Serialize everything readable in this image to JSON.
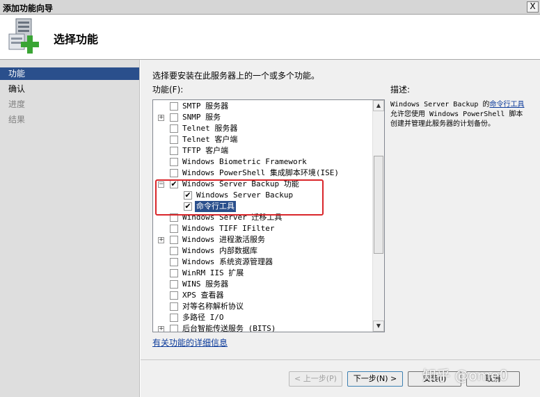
{
  "window": {
    "title": "添加功能向导",
    "close_glyph": "X"
  },
  "header": {
    "title": "选择功能",
    "icon": "server-add-icon"
  },
  "nav": [
    {
      "label": "功能",
      "state": "active"
    },
    {
      "label": "确认",
      "state": "normal"
    },
    {
      "label": "进度",
      "state": "disabled"
    },
    {
      "label": "结果",
      "state": "disabled"
    }
  ],
  "main": {
    "intro": "选择要安装在此服务器上的一个或多个功能。",
    "features_label": "功能(F):",
    "more_info_link": "有关功能的详细信息"
  },
  "features": [
    {
      "label": "SMTP 服务器",
      "checked": false,
      "expander": "",
      "indent": 0,
      "selected": false
    },
    {
      "label": "SNMP 服务",
      "checked": false,
      "expander": "+",
      "indent": 0,
      "selected": false
    },
    {
      "label": "Telnet 服务器",
      "checked": false,
      "expander": "",
      "indent": 0,
      "selected": false
    },
    {
      "label": "Telnet 客户端",
      "checked": false,
      "expander": "",
      "indent": 0,
      "selected": false
    },
    {
      "label": "TFTP 客户端",
      "checked": false,
      "expander": "",
      "indent": 0,
      "selected": false
    },
    {
      "label": "Windows Biometric Framework",
      "checked": false,
      "expander": "",
      "indent": 0,
      "selected": false
    },
    {
      "label": "Windows PowerShell 集成脚本环境(ISE)",
      "checked": false,
      "expander": "",
      "indent": 0,
      "selected": false
    },
    {
      "label": "Windows Server Backup 功能",
      "checked": true,
      "expander": "−",
      "indent": 0,
      "selected": false
    },
    {
      "label": "Windows Server Backup",
      "checked": true,
      "expander": "",
      "indent": 1,
      "selected": false
    },
    {
      "label": "命令行工具",
      "checked": true,
      "expander": "",
      "indent": 1,
      "selected": true
    },
    {
      "label": "Windows Server 迁移工具",
      "checked": false,
      "expander": "",
      "indent": 0,
      "selected": false
    },
    {
      "label": "Windows TIFF IFilter",
      "checked": false,
      "expander": "",
      "indent": 0,
      "selected": false
    },
    {
      "label": "Windows 进程激活服务",
      "checked": false,
      "expander": "+",
      "indent": 0,
      "selected": false
    },
    {
      "label": "Windows 内部数据库",
      "checked": false,
      "expander": "",
      "indent": 0,
      "selected": false
    },
    {
      "label": "Windows 系统资源管理器",
      "checked": false,
      "expander": "",
      "indent": 0,
      "selected": false
    },
    {
      "label": "WinRM IIS 扩展",
      "checked": false,
      "expander": "",
      "indent": 0,
      "selected": false
    },
    {
      "label": "WINS 服务器",
      "checked": false,
      "expander": "",
      "indent": 0,
      "selected": false
    },
    {
      "label": "XPS 查看器",
      "checked": false,
      "expander": "",
      "indent": 0,
      "selected": false
    },
    {
      "label": "对等名称解析协议",
      "checked": false,
      "expander": "",
      "indent": 0,
      "selected": false
    },
    {
      "label": "多路径 I/O",
      "checked": false,
      "expander": "",
      "indent": 0,
      "selected": false
    },
    {
      "label": "后台智能传送服务 (BITS)",
      "checked": false,
      "expander": "+",
      "indent": 0,
      "selected": false
    }
  ],
  "description": {
    "title": "描述:",
    "text_before": "Windows Server Backup 的",
    "link": "命令行工具",
    "text_after": "允许您使用 Windows PowerShell 脚本创建并管理此服务器的计划备份。"
  },
  "buttons": {
    "prev": "< 上一步(P)",
    "next": "下一步(N) >",
    "install": "安装(I)",
    "cancel": "取消"
  },
  "watermark": "知乎 @ome0",
  "colors": {
    "selection": "#2a4f8c",
    "highlight_box": "#d9262a",
    "link": "#0b3a9a"
  }
}
